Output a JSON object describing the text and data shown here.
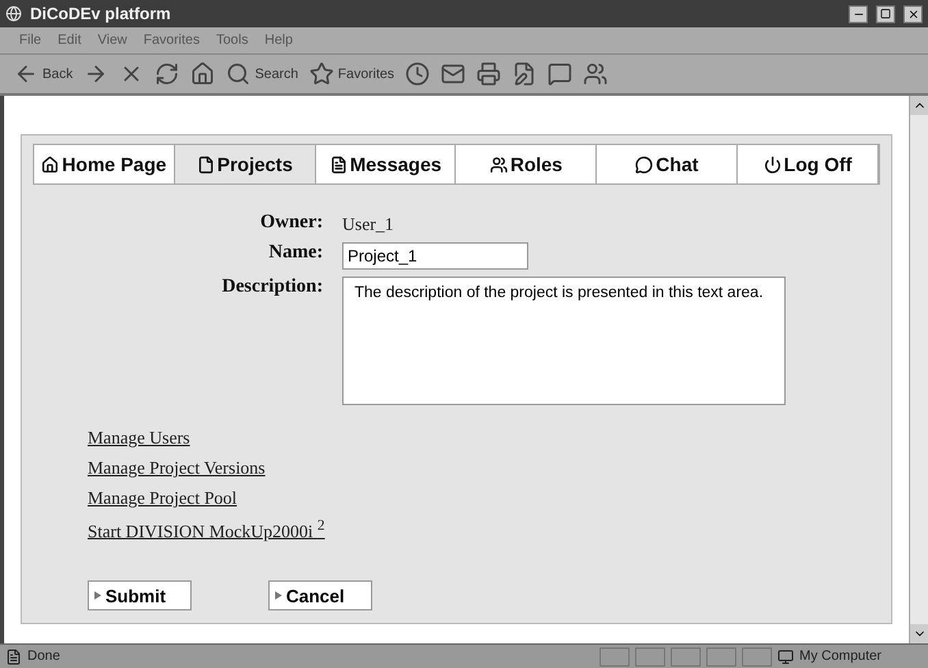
{
  "window": {
    "title": "DiCoDEv platform"
  },
  "menu": [
    "File",
    "Edit",
    "View",
    "Favorites",
    "Tools",
    "Help"
  ],
  "toolbar": [
    {
      "kind": "back",
      "label": "Back"
    },
    {
      "kind": "forward"
    },
    {
      "kind": "stop"
    },
    {
      "kind": "refresh"
    },
    {
      "kind": "home"
    },
    {
      "kind": "search",
      "label": "Search"
    },
    {
      "kind": "favorites",
      "label": "Favorites"
    },
    {
      "kind": "history"
    },
    {
      "kind": "mail"
    },
    {
      "kind": "print"
    },
    {
      "kind": "edit"
    },
    {
      "kind": "discuss"
    },
    {
      "kind": "messenger"
    }
  ],
  "tabs": [
    {
      "label": "Home Page",
      "selected": false
    },
    {
      "label": "Projects",
      "selected": true
    },
    {
      "label": "Messages",
      "selected": false
    },
    {
      "label": "Roles",
      "selected": false
    },
    {
      "label": "Chat",
      "selected": false
    },
    {
      "label": "Log Off",
      "selected": false
    }
  ],
  "form": {
    "owner_label": "Owner:",
    "owner": "User_1",
    "name_label": "Name:",
    "name": "Project_1",
    "description_label": "Description:",
    "description": "The description of the project is presented in this text area."
  },
  "links": [
    "Manage Users",
    "Manage Project Versions",
    "Manage Project Pool",
    "Start DIVISION MockUp2000i $^{2}$"
  ],
  "buttons": [
    "Submit",
    "Cancel"
  ],
  "status_bar": {
    "text": "Done",
    "zone": "My Computer"
  }
}
